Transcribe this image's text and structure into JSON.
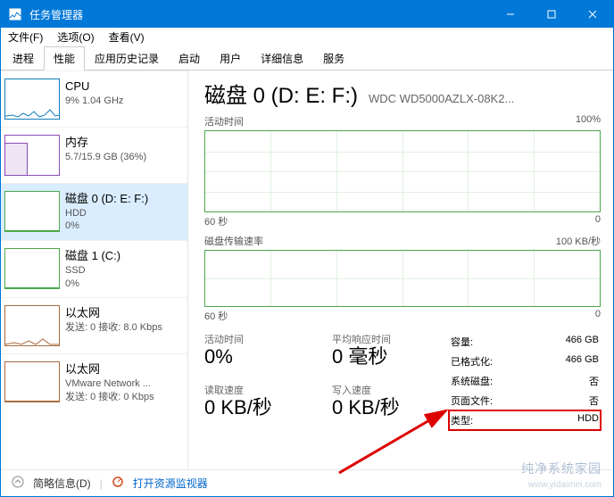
{
  "window": {
    "title": "任务管理器"
  },
  "menu": {
    "file": "文件(F)",
    "options": "选项(O)",
    "view": "查看(V)"
  },
  "tabs": [
    "进程",
    "性能",
    "应用历史记录",
    "启动",
    "用户",
    "详细信息",
    "服务"
  ],
  "active_tab_index": 1,
  "sidebar": [
    {
      "name": "cpu",
      "title": "CPU",
      "sub": "9% 1.04 GHz",
      "selected": false
    },
    {
      "name": "mem",
      "title": "内存",
      "sub": "5.7/15.9 GB (36%)",
      "selected": false
    },
    {
      "name": "disk0",
      "title": "磁盘 0 (D: E: F:)",
      "sub": "HDD",
      "sub2": "0%",
      "selected": true
    },
    {
      "name": "disk1",
      "title": "磁盘 1 (C:)",
      "sub": "SSD",
      "sub2": "0%",
      "selected": false
    },
    {
      "name": "eth0",
      "title": "以太网",
      "sub": "发送: 0 接收: 8.0 Kbps",
      "selected": false
    },
    {
      "name": "eth1",
      "title": "以太网",
      "sub": "VMware Network ...",
      "sub2": "发送: 0 接收: 0 Kbps",
      "selected": false
    }
  ],
  "main": {
    "title": "磁盘 0 (D: E: F:)",
    "model": "WDC WD5000AZLX-08K2...",
    "chart1": {
      "label": "活动时间",
      "max": "100%",
      "foot": "60 秒"
    },
    "chart2": {
      "label": "磁盘传输速率",
      "max": "100 KB/秒",
      "foot": "60 秒"
    },
    "stats_left": {
      "active_time_label": "活动时间",
      "active_time_value": "0%",
      "avg_resp_label": "平均响应时间",
      "avg_resp_value": "0 毫秒",
      "read_label": "读取速度",
      "read_value": "0 KB/秒",
      "write_label": "写入速度",
      "write_value": "0 KB/秒"
    },
    "stats_right": {
      "capacity_k": "容量:",
      "capacity_v": "466 GB",
      "formatted_k": "已格式化:",
      "formatted_v": "466 GB",
      "sysdisk_k": "系统磁盘:",
      "sysdisk_v": "否",
      "pagefile_k": "页面文件:",
      "pagefile_v": "否",
      "type_k": "类型:",
      "type_v": "HDD"
    }
  },
  "footer": {
    "fewer": "简略信息(D)",
    "resmon": "打开资源监视器"
  },
  "watermark": {
    "main": "纯净系统家园",
    "sub": "www.yidaimei.com"
  },
  "chart_data": {
    "type": "line",
    "title": "磁盘 0 活动时间 / 传输速率",
    "series": [
      {
        "name": "活动时间 (%)",
        "ylim": [
          0,
          100
        ],
        "x_range": "60 秒",
        "values_approx": "~0 throughout"
      },
      {
        "name": "磁盘传输速率 (KB/秒)",
        "ylim": [
          0,
          100
        ],
        "x_range": "60 秒",
        "values_approx": "~0 throughout"
      }
    ]
  }
}
